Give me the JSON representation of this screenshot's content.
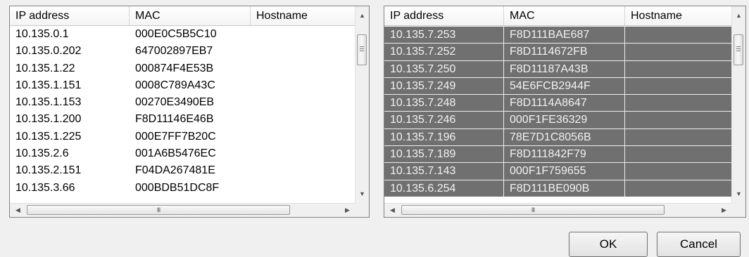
{
  "columns": [
    "IP address",
    "MAC",
    "Hostname"
  ],
  "left_list": {
    "rows": [
      {
        "ip": "10.135.0.1",
        "mac": "000E0C5B5C10",
        "host": ""
      },
      {
        "ip": "10.135.0.202",
        "mac": "647002897EB7",
        "host": ""
      },
      {
        "ip": "10.135.1.22",
        "mac": "000874F4E53B",
        "host": ""
      },
      {
        "ip": "10.135.1.151",
        "mac": "0008C789A43C",
        "host": ""
      },
      {
        "ip": "10.135.1.153",
        "mac": "00270E3490EB",
        "host": ""
      },
      {
        "ip": "10.135.1.200",
        "mac": "F8D11146E46B",
        "host": ""
      },
      {
        "ip": "10.135.1.225",
        "mac": "000E7FF7B20C",
        "host": ""
      },
      {
        "ip": "10.135.2.6",
        "mac": "001A6B5476EC",
        "host": ""
      },
      {
        "ip": "10.135.2.151",
        "mac": "F04DA267481E",
        "host": ""
      },
      {
        "ip": "10.135.3.66",
        "mac": "000BDB51DC8F",
        "host": ""
      }
    ]
  },
  "right_list": {
    "rows": [
      {
        "ip": "10.135.7.253",
        "mac": "F8D111BAE687",
        "host": ""
      },
      {
        "ip": "10.135.7.252",
        "mac": "F8D1114672FB",
        "host": ""
      },
      {
        "ip": "10.135.7.250",
        "mac": "F8D11187A43B",
        "host": ""
      },
      {
        "ip": "10.135.7.249",
        "mac": "54E6FCB2944F",
        "host": ""
      },
      {
        "ip": "10.135.7.248",
        "mac": "F8D1114A8647",
        "host": ""
      },
      {
        "ip": "10.135.7.246",
        "mac": "000F1FE36329",
        "host": ""
      },
      {
        "ip": "10.135.7.196",
        "mac": "78E7D1C8056B",
        "host": ""
      },
      {
        "ip": "10.135.7.189",
        "mac": "F8D111842F79",
        "host": ""
      },
      {
        "ip": "10.135.7.143",
        "mac": "000F1F759655",
        "host": ""
      },
      {
        "ip": "10.135.6.254",
        "mac": "F8D111BE090B",
        "host": ""
      }
    ]
  },
  "buttons": {
    "ok": "OK",
    "cancel": "Cancel"
  },
  "icons": {
    "up": "▲",
    "down": "▼",
    "left": "◀",
    "right": "▶",
    "grip": "III"
  },
  "colors": {
    "selection": "#707070"
  }
}
